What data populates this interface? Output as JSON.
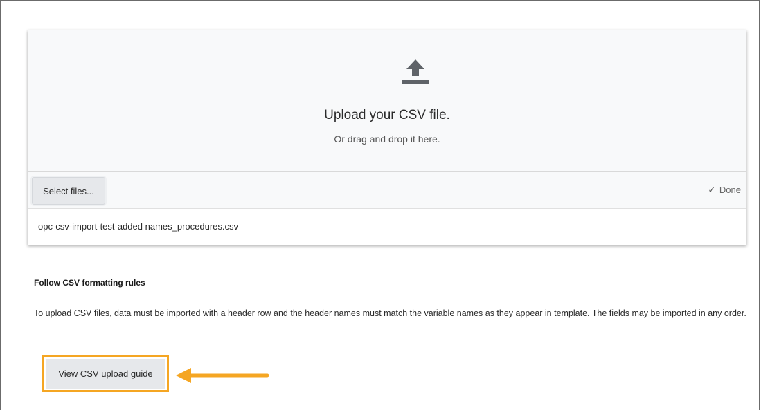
{
  "upload": {
    "title": "Upload your CSV file.",
    "subtitle": "Or drag and drop it here.",
    "select_button": "Select files...",
    "status": "Done",
    "file_name": "opc-csv-import-test-added names_procedures.csv"
  },
  "rules": {
    "heading": "Follow CSV formatting rules",
    "text": "To upload CSV files, data must be imported with a header row and the header names must match the variable names as they appear in template. The fields may be imported in any order.",
    "guide_button": "View CSV upload guide"
  },
  "icons": {
    "upload": "upload-icon",
    "check": "check-icon",
    "callout": "arrow-left-icon"
  },
  "colors": {
    "highlight": "#f5a623",
    "icon": "#5f6368"
  }
}
